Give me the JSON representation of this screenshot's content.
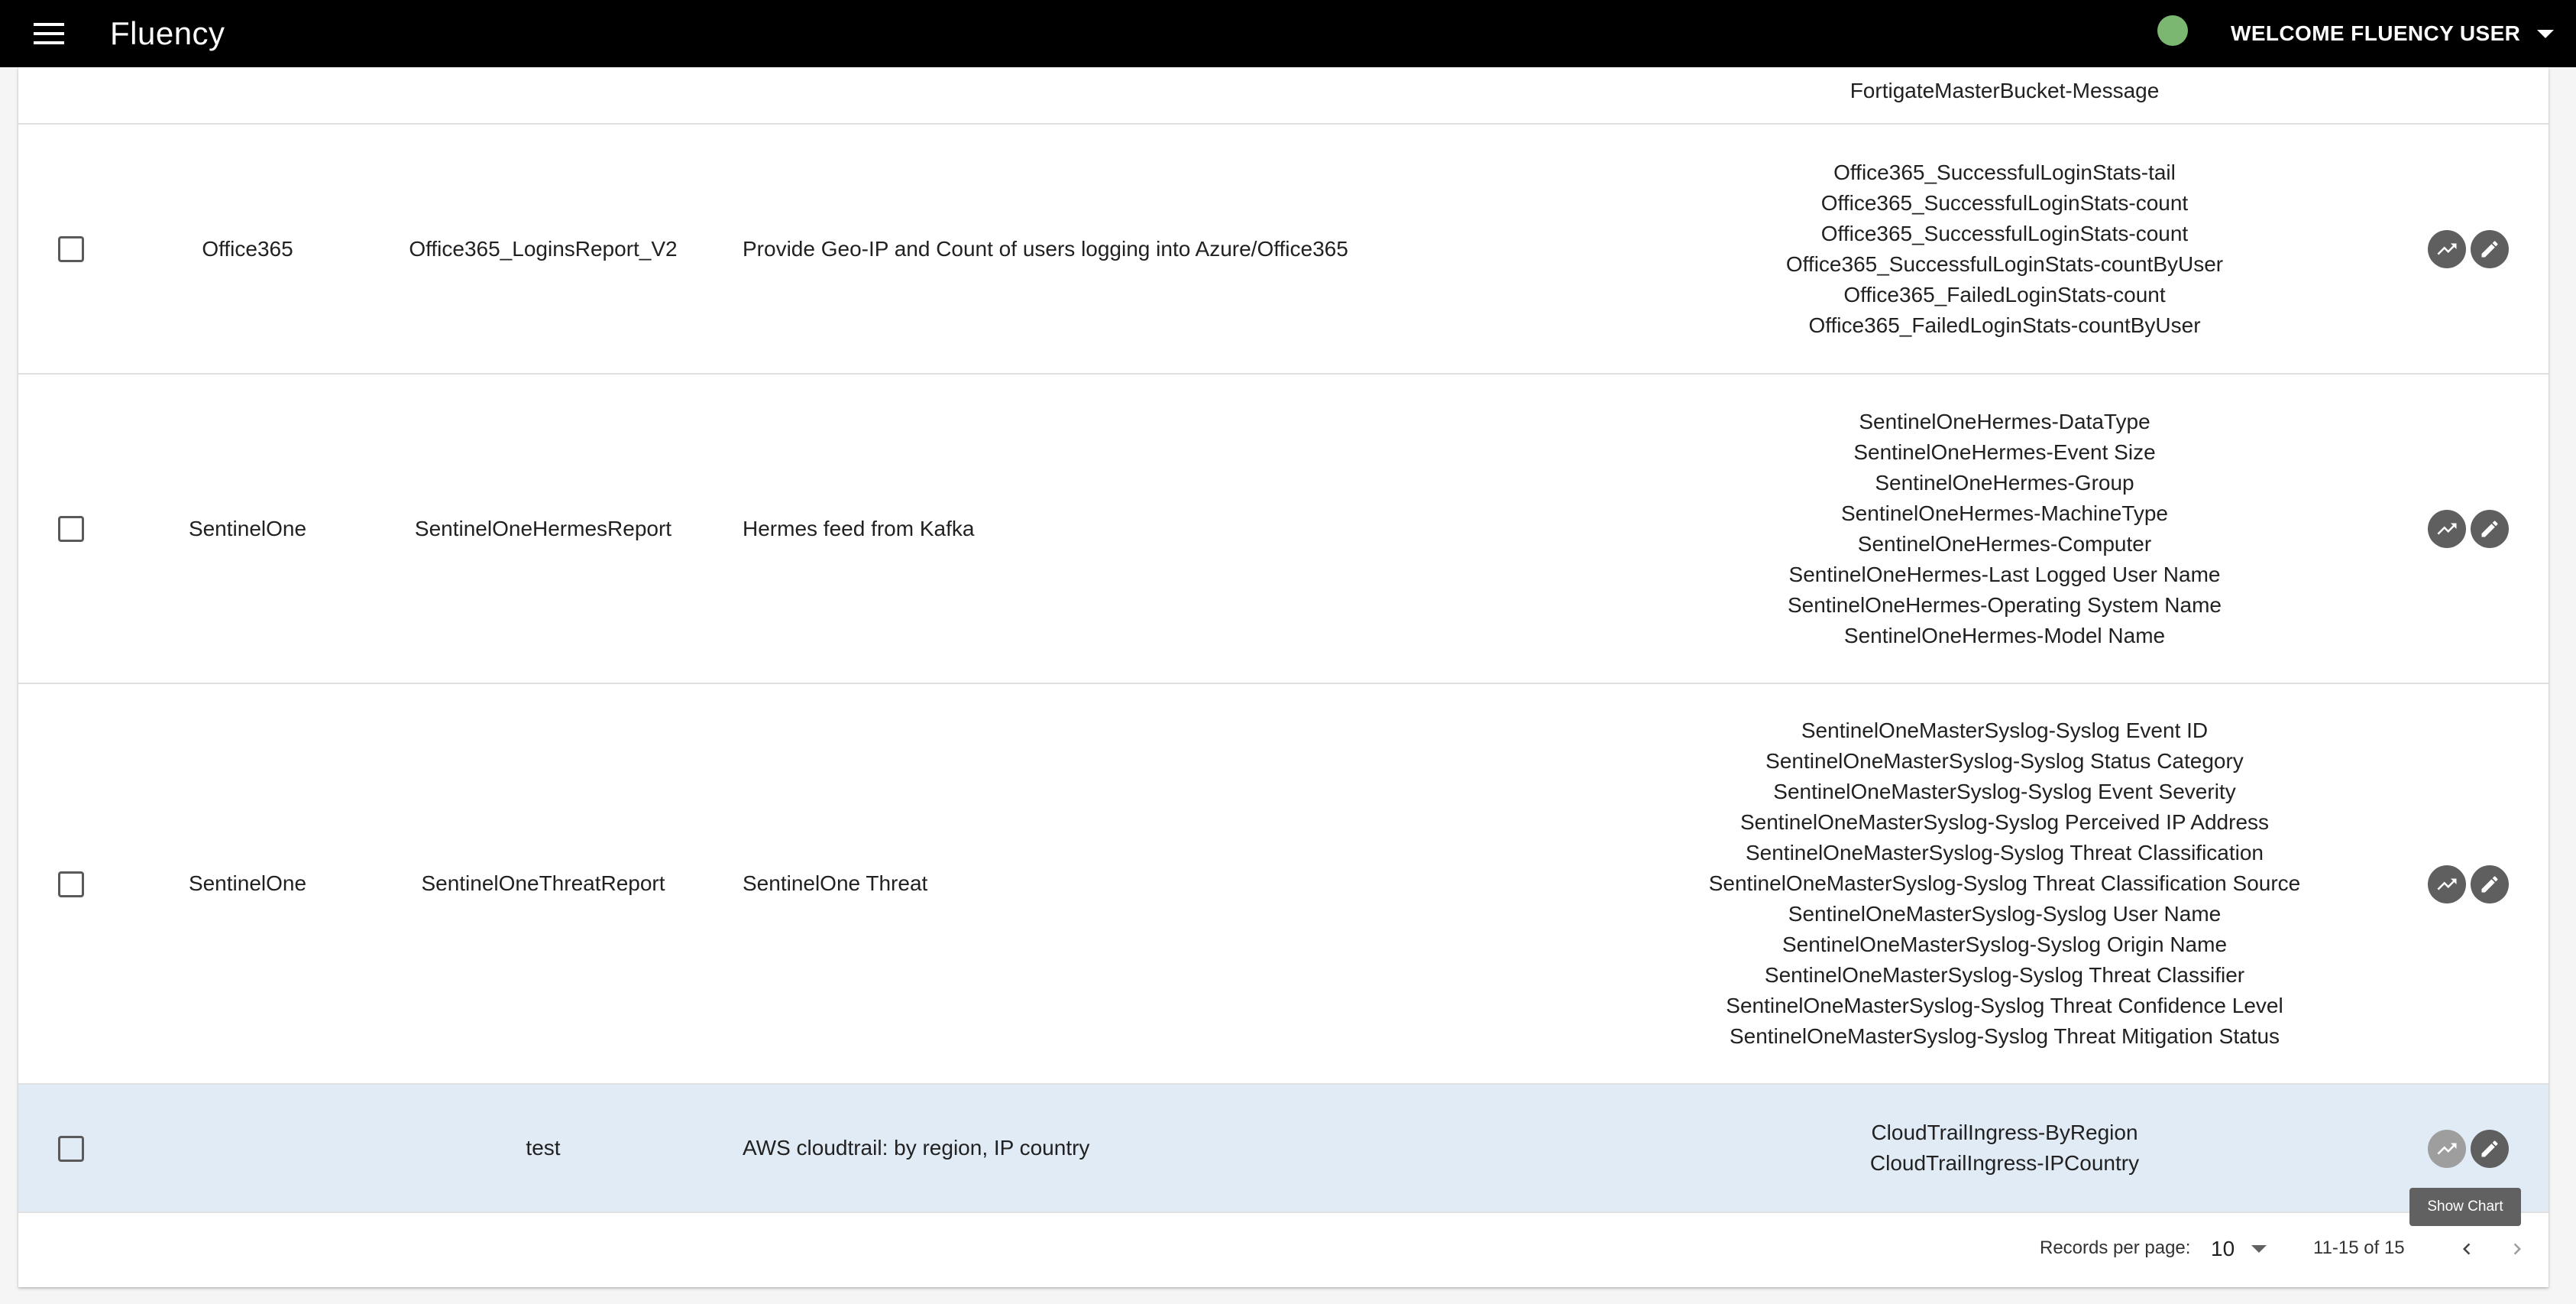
{
  "app": {
    "title": "Fluency",
    "user_label": "WELCOME FLUENCY USER",
    "status_color": "#7cb772"
  },
  "rows": [
    {
      "source": "",
      "name": "",
      "description": "",
      "fields": [
        "FortigateMasterBucket-Message"
      ]
    },
    {
      "source": "Office365",
      "name": "Office365_LoginsReport_V2",
      "description": "Provide Geo-IP and Count of users logging into Azure/Office365",
      "fields": [
        "Office365_SuccessfulLoginStats-tail",
        "Office365_SuccessfulLoginStats-count",
        "Office365_SuccessfulLoginStats-count",
        "Office365_SuccessfulLoginStats-countByUser",
        "Office365_FailedLoginStats-count",
        "Office365_FailedLoginStats-countByUser"
      ]
    },
    {
      "source": "SentinelOne",
      "name": "SentinelOneHermesReport",
      "description": "Hermes feed from Kafka",
      "fields": [
        "SentinelOneHermes-DataType",
        "SentinelOneHermes-Event Size",
        "SentinelOneHermes-Group",
        "SentinelOneHermes-MachineType",
        "SentinelOneHermes-Computer",
        "SentinelOneHermes-Last Logged User Name",
        "SentinelOneHermes-Operating System Name",
        "SentinelOneHermes-Model Name"
      ]
    },
    {
      "source": "SentinelOne",
      "name": "SentinelOneThreatReport",
      "description": "SentinelOne Threat",
      "fields": [
        "SentinelOneMasterSyslog-Syslog Event ID",
        "SentinelOneMasterSyslog-Syslog Status Category",
        "SentinelOneMasterSyslog-Syslog Event Severity",
        "SentinelOneMasterSyslog-Syslog Perceived IP Address",
        "SentinelOneMasterSyslog-Syslog Threat Classification",
        "SentinelOneMasterSyslog-Syslog Threat Classification Source",
        "SentinelOneMasterSyslog-Syslog User Name",
        "SentinelOneMasterSyslog-Syslog Origin Name",
        "SentinelOneMasterSyslog-Syslog Threat Classifier",
        "SentinelOneMasterSyslog-Syslog Threat Confidence Level",
        "SentinelOneMasterSyslog-Syslog Threat Mitigation Status"
      ]
    },
    {
      "source": "",
      "name": "test",
      "description": "AWS cloudtrail: by region, IP country",
      "fields": [
        "CloudTrailIngress-ByRegion",
        "CloudTrailIngress-IPCountry"
      ]
    }
  ],
  "tooltip": "Show Chart",
  "pagination": {
    "rows_per_page_label": "Records per page:",
    "rows_per_page_value": "10",
    "range": "11-15 of 15"
  }
}
